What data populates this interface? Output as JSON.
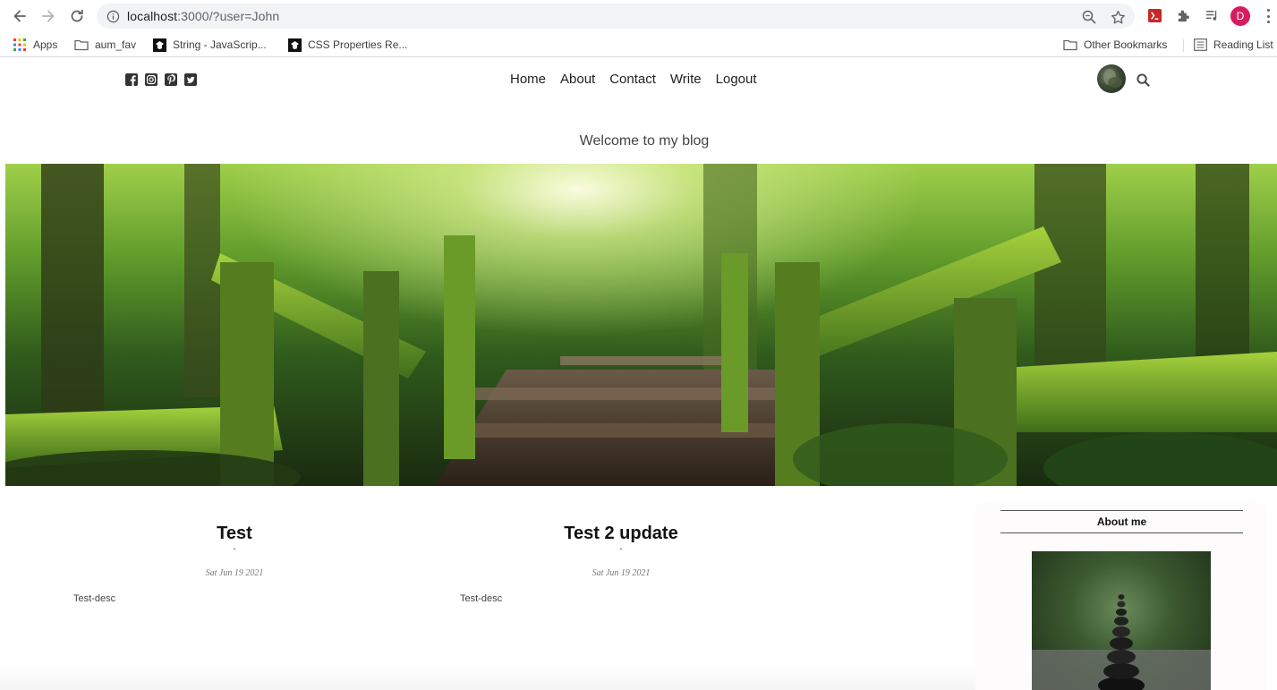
{
  "browser": {
    "url_host": "localhost",
    "url_path": ":3000/?user=John",
    "profile_initial": "D",
    "bookmarks": [
      {
        "label": "Apps",
        "icon": "apps-grid-icon"
      },
      {
        "label": "aum_fav",
        "icon": "folder-icon"
      },
      {
        "label": "String - JavaScrip...",
        "icon": "site-favicon-icon"
      },
      {
        "label": "CSS Properties Re...",
        "icon": "site-favicon-icon"
      }
    ],
    "other_bookmarks": "Other Bookmarks",
    "reading_list": "Reading List"
  },
  "site": {
    "socials": [
      "facebook-icon",
      "instagram-icon",
      "pinterest-icon",
      "twitter-icon"
    ],
    "nav": [
      "Home",
      "About",
      "Contact",
      "Write",
      "Logout"
    ],
    "header_title": "Welcome to my blog"
  },
  "posts": [
    {
      "title": "Test",
      "date": "Sat Jun 19 2021",
      "desc": "Test-desc"
    },
    {
      "title": "Test 2 update",
      "date": "Sat Jun 19 2021",
      "desc": "Test-desc"
    }
  ],
  "sidebar": {
    "title": "About me"
  },
  "colors": {
    "profile": "#d81b60",
    "omnibox_bg": "#f1f3f4"
  }
}
